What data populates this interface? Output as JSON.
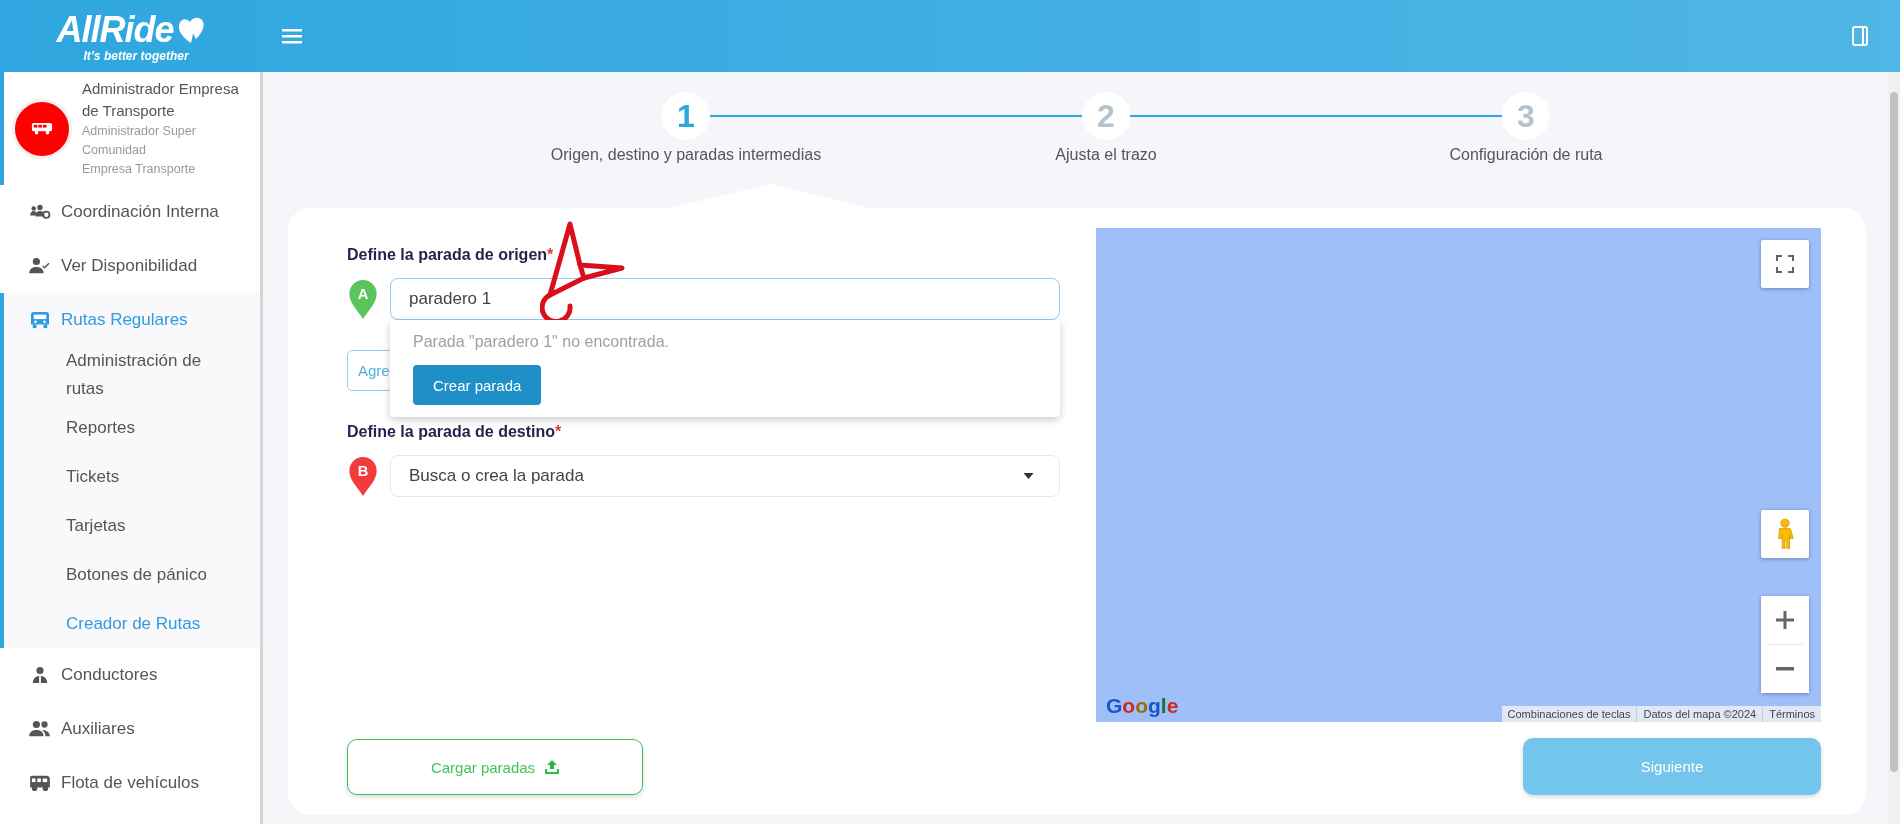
{
  "header": {
    "brand": "AllRide",
    "tagline": "It’s better together"
  },
  "profile": {
    "name": "Administrador Empresa de Transporte",
    "roles": [
      "Administrador Super",
      "Comunidad",
      "Empresa Transporte"
    ]
  },
  "menu": [
    {
      "label": "Coordinación Interna",
      "selected": false
    },
    {
      "label": "Ver Disponibilidad",
      "selected": false
    },
    {
      "label": "Rutas Regulares",
      "selected": true,
      "children": [
        {
          "label": "Administración de rutas",
          "selected": false
        },
        {
          "label": "Reportes",
          "selected": false
        },
        {
          "label": "Tickets",
          "selected": false
        },
        {
          "label": "Tarjetas",
          "selected": false
        },
        {
          "label": "Botones de pánico",
          "selected": false
        },
        {
          "label": "Creador de Rutas",
          "selected": true
        }
      ]
    },
    {
      "label": "Conductores",
      "selected": false
    },
    {
      "label": "Auxiliares",
      "selected": false
    },
    {
      "label": "Flota de vehículos",
      "selected": false
    }
  ],
  "stepper": [
    {
      "number": "1",
      "label": "Origen, destino y paradas intermedias",
      "active": true
    },
    {
      "number": "2",
      "label": "Ajusta el trazo",
      "active": false
    },
    {
      "number": "3",
      "label": "Configuración de ruta",
      "active": false
    }
  ],
  "origin": {
    "label": "Define la parada de origen",
    "required": "*",
    "pin": "A",
    "value": "paradero 1",
    "suggestions": {
      "message": "Parada \"paradero 1\" no encontrada.",
      "button": "Crear parada"
    },
    "hidden_button": "Agre"
  },
  "destination": {
    "label": "Define la parada de destino",
    "required": "*",
    "pin": "B",
    "placeholder": "Busca o crea la parada"
  },
  "map": {
    "logo": "Google",
    "attribution": [
      "Combinaciones de teclas",
      "Datos del mapa ©2024",
      "Términos"
    ]
  },
  "buttons": {
    "upload": "Cargar paradas",
    "next": "Siguiente",
    "next_disabled": true
  }
}
